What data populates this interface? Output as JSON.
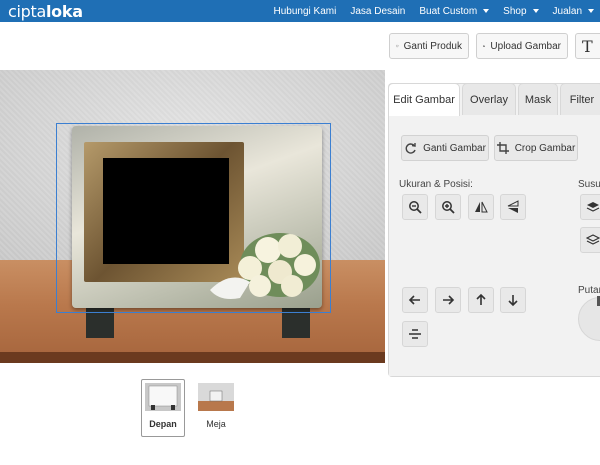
{
  "brand": {
    "logo_part1": "cipta",
    "logo_part2": "loka"
  },
  "nav": {
    "items": [
      {
        "label": "Hubungi Kami",
        "dropdown": false
      },
      {
        "label": "Jasa Desain",
        "dropdown": false
      },
      {
        "label": "Buat Custom",
        "dropdown": true
      },
      {
        "label": "Shop",
        "dropdown": true
      },
      {
        "label": "Jualan",
        "dropdown": true
      }
    ]
  },
  "toolbar": {
    "ganti_produk": "Ganti Produk",
    "upload_gambar": "Upload Gambar",
    "text_partial": "T"
  },
  "thumbnails": [
    {
      "label": "Depan",
      "selected": true
    },
    {
      "label": "Meja",
      "selected": false
    }
  ],
  "panel": {
    "tabs": [
      "Edit Gambar",
      "Overlay",
      "Mask",
      "Filter"
    ],
    "active_tab": "Edit Gambar",
    "ganti_gambar": "Ganti Gambar",
    "crop_gambar": "Crop Gambar",
    "ukuran_posisi": "Ukuran & Posisi:",
    "susun_partial": "Susun",
    "putar_partial": "Putar"
  },
  "colors": {
    "navbar": "#1f6fb5",
    "selection": "#3b7fd1",
    "panel_bg": "#f2f2f2"
  }
}
